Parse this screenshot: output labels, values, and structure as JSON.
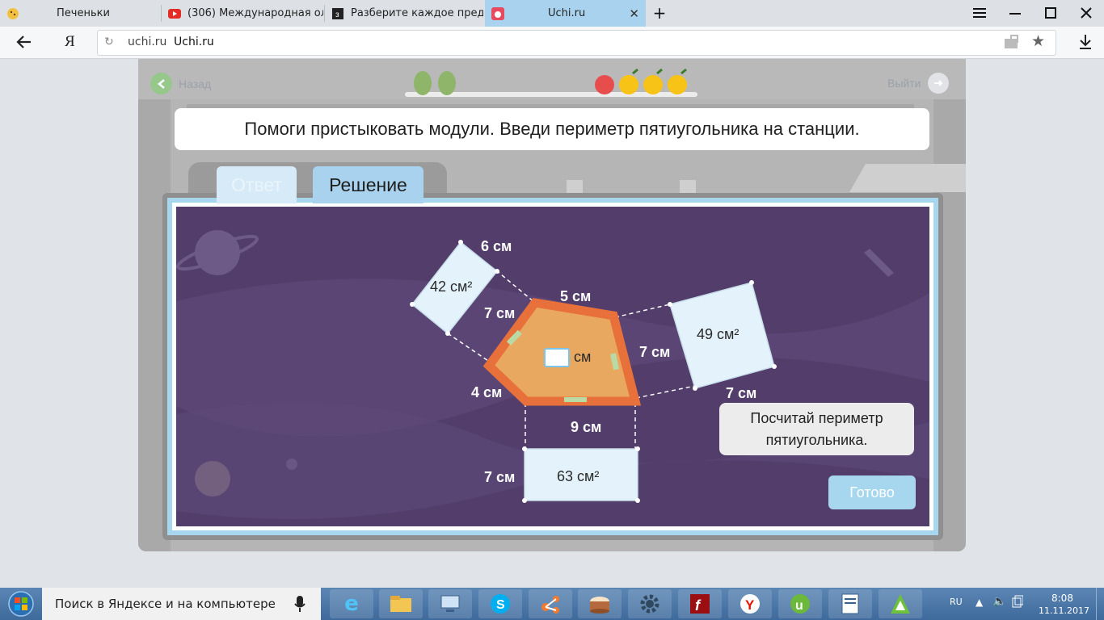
{
  "browser": {
    "tabs": [
      {
        "title": "Печеньки"
      },
      {
        "title": "(306) Международная олим"
      },
      {
        "title": "Разберите каждое предлож"
      },
      {
        "title": "Uchi.ru"
      }
    ],
    "new_tab": "+",
    "yandex_logo": "Я",
    "url_domain": "uchi.ru",
    "url_title": "Uchi.ru"
  },
  "lesson": {
    "back_label": "Назад",
    "exit_label": "Выйти",
    "prompt": "Помоги пристыковать модули. Введи периметр пятиугольника на станции.",
    "tab_answer": "Ответ",
    "tab_solution": "Решение",
    "hint": "Посчитай периметр пятиугольника.",
    "done_label": "Готово",
    "answer_value": "",
    "answer_unit": "см",
    "labels": {
      "top_left_side": "6 см",
      "top_left_area": "42 см²",
      "pent_upper_left": "7 см",
      "pent_top": "5 см",
      "pent_right": "7 см",
      "right_area": "49 см²",
      "right_bottom": "7 см",
      "pent_left": "4 см",
      "pent_bottom": "9 см",
      "bottom_side": "7 см",
      "bottom_area": "63 см²"
    }
  },
  "taskbar": {
    "search_text": "Поиск в Яндексе и на компьютере",
    "lang": "RU",
    "time": "8:08",
    "date": "11.11.2017"
  },
  "colors": {
    "space_bg": "#523d6b",
    "pentagon_fill": "#e8a860",
    "pentagon_border": "#e8703a",
    "module_fill": "#e4f3fb",
    "frame_blue": "#a7d6ef",
    "tab_active": "#a9d2ee"
  }
}
